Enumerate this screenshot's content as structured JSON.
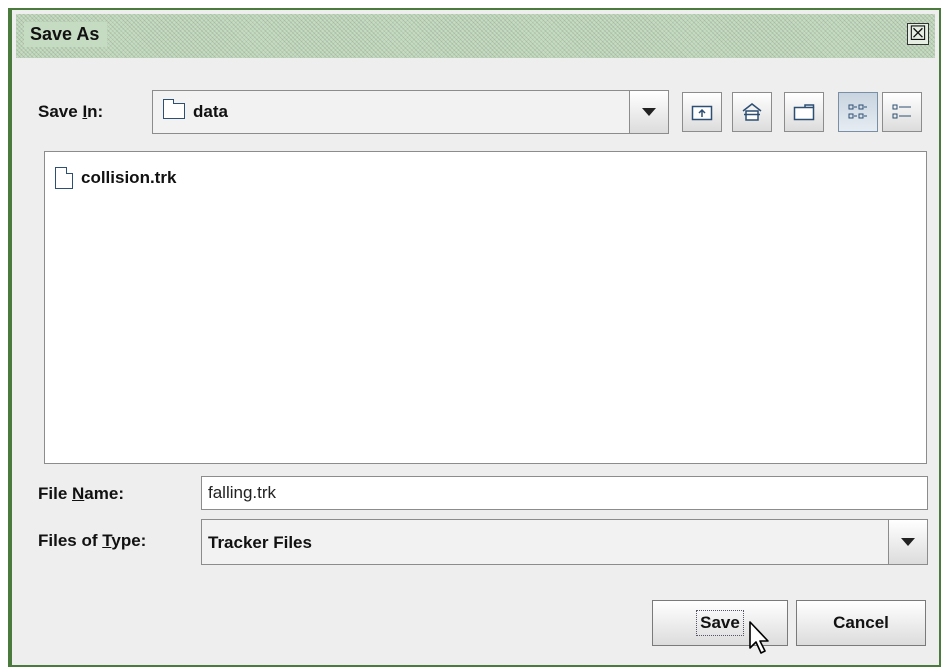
{
  "window": {
    "title": "Save As",
    "close_glyph": "☒"
  },
  "save_in": {
    "label_pre": "Save ",
    "label_mnemonic": "I",
    "label_post": "n:",
    "value": "data"
  },
  "toolbar": {
    "icons": [
      "up-folder-icon",
      "home-icon",
      "new-folder-icon",
      "list-view-icon",
      "details-view-icon"
    ],
    "active": "list-view-icon"
  },
  "file_list": {
    "items": [
      {
        "name": "collision.trk",
        "icon": "file-icon"
      }
    ]
  },
  "file_name": {
    "label_pre": "File ",
    "label_mnemonic": "N",
    "label_post": "ame:",
    "value": "falling.trk"
  },
  "file_type": {
    "label_pre": "Files of ",
    "label_mnemonic": "T",
    "label_post": "ype:",
    "value": "Tracker Files"
  },
  "buttons": {
    "save": "Save",
    "cancel": "Cancel"
  },
  "colors": {
    "frame": "#4a7a3c",
    "titlebar": "#c6dcc2",
    "dialog_bg": "#eeeeee"
  }
}
